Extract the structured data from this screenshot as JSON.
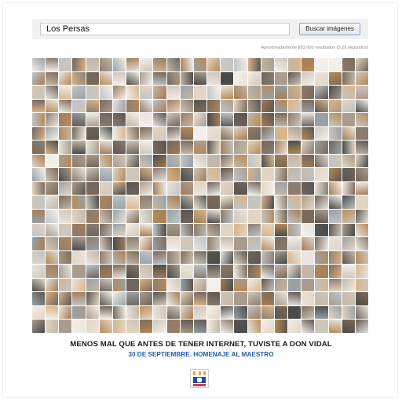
{
  "search": {
    "query": "Los Persas",
    "button_label": "Buscar imágenes",
    "result_stats": "Aproximadamente 893.000 resultados (0,29 segundos)"
  },
  "results_grid": {
    "description": "cat-photo-thumbnail-mosaic",
    "palette": [
      "#e9e4dd",
      "#cfc6ba",
      "#a99c8c",
      "#8a7d70",
      "#6f655d",
      "#b58a5a",
      "#d9b48a",
      "#f3efe9",
      "#9aa1a6",
      "#5b5550",
      "#c2b7a8",
      "#7c6a58",
      "#e2d5c4",
      "#4a4a4a",
      "#bfc4c7",
      "#a37c58"
    ]
  },
  "footer": {
    "headline": "MENOS MAL QUE ANTES DE TENER INTERNET, TUVISTE A DON VIDAL",
    "subline": "30 DE SEPTIEMBRE. HOMENAJE AL MAESTRO",
    "logo_name": "fed-logo"
  }
}
